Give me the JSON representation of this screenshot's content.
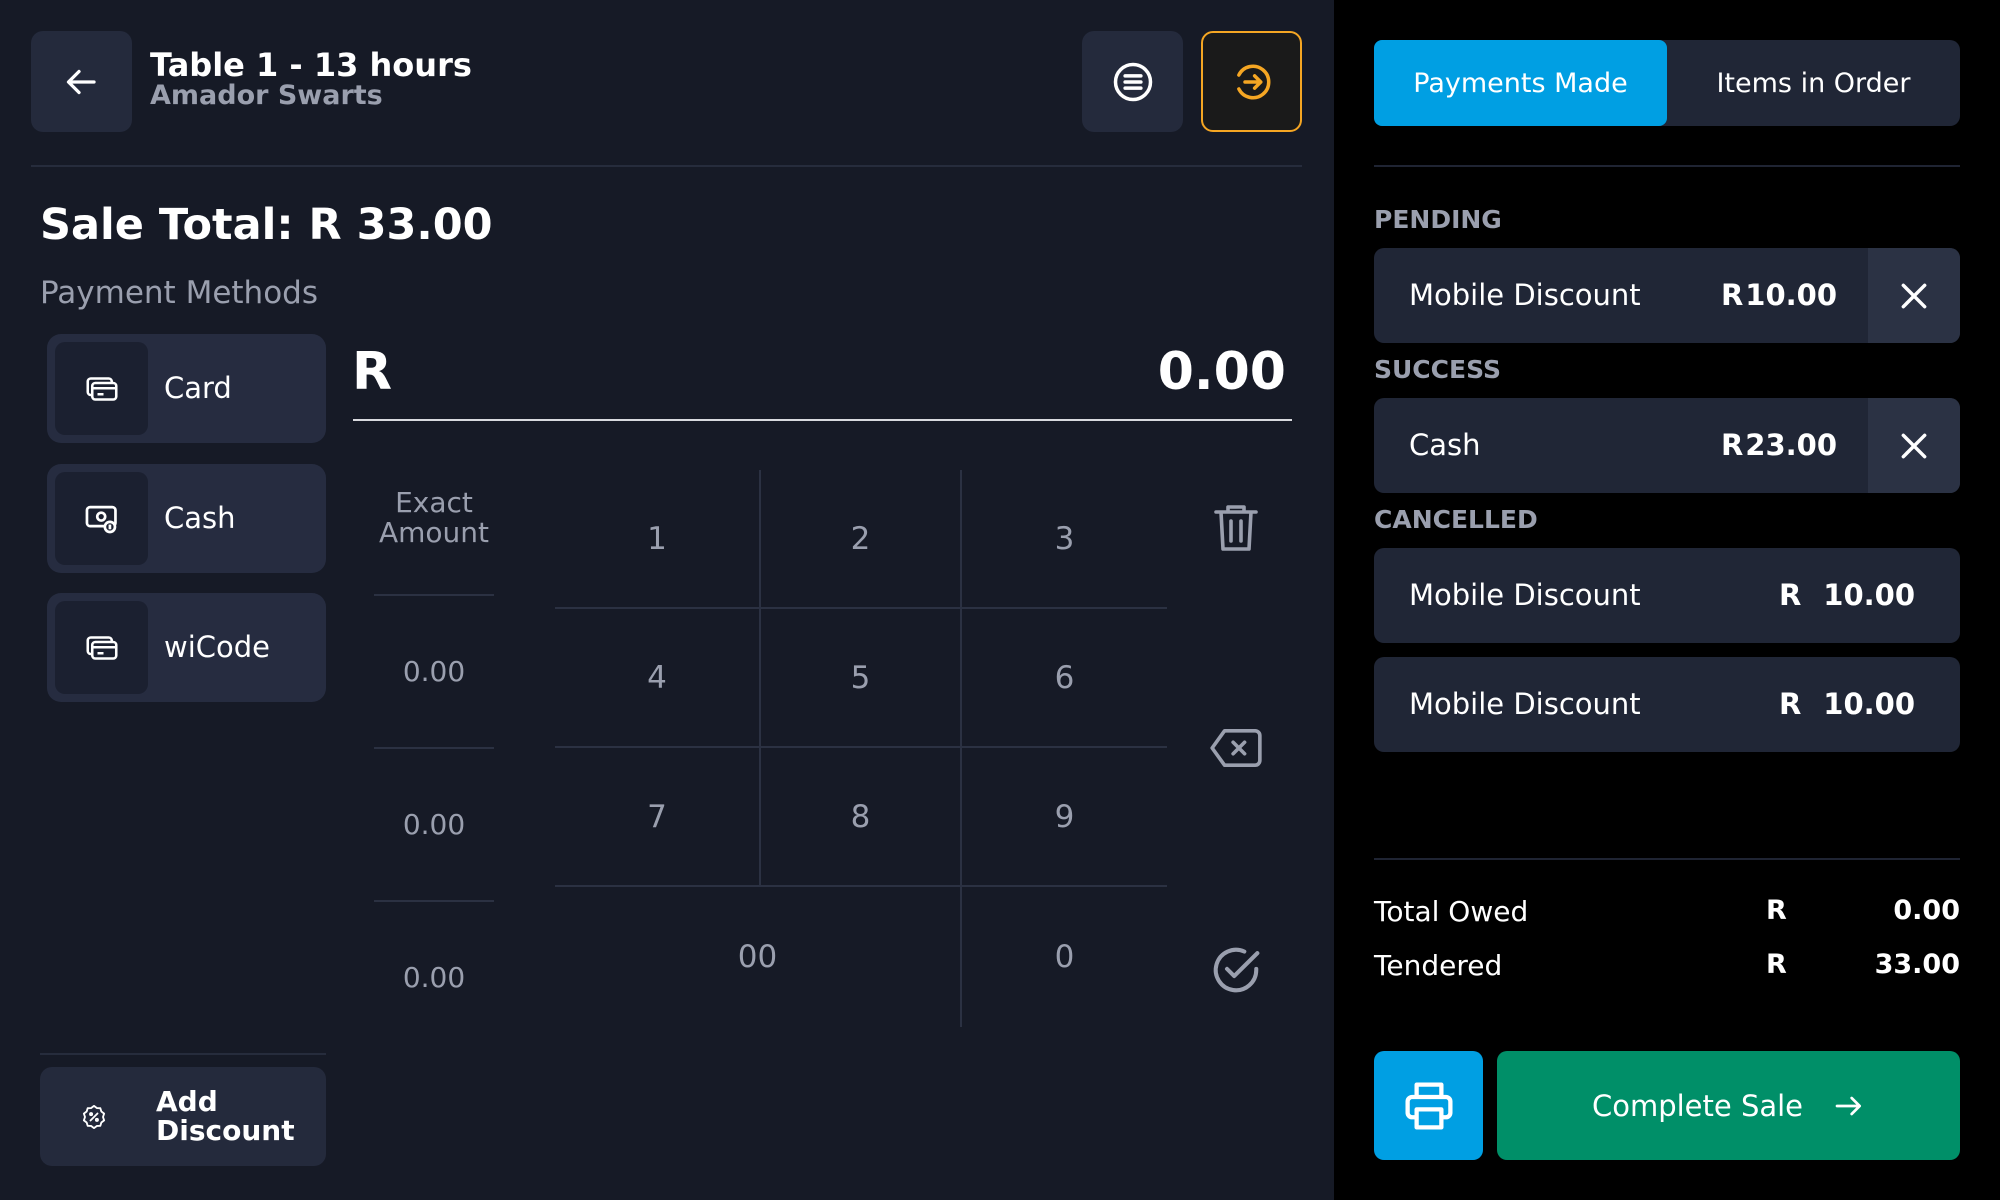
{
  "header": {
    "title": "Table 1 - 13 hours",
    "subtitle": "Amador Swarts"
  },
  "sale_total": "Sale Total: R 33.00",
  "payment_methods_title": "Payment Methods",
  "payment_methods": [
    {
      "label": "Card",
      "icon": "card-icon"
    },
    {
      "label": "Cash",
      "icon": "cash-icon"
    },
    {
      "label": "wiCode",
      "icon": "wicode-icon"
    }
  ],
  "add_discount_label": "Add Discount",
  "amount": {
    "currency": "R",
    "value": "0.00"
  },
  "quick_amounts": {
    "exact_label": "Exact Amount",
    "values": [
      "0.00",
      "0.00",
      "0.00"
    ]
  },
  "keypad": {
    "keys": [
      "1",
      "2",
      "3",
      "4",
      "5",
      "6",
      "7",
      "8",
      "9",
      "00",
      "0"
    ]
  },
  "tabs": [
    {
      "label": "Payments Made",
      "active": true
    },
    {
      "label": "Items in Order",
      "active": false
    }
  ],
  "sections": {
    "pending": {
      "label": "PENDING",
      "rows": [
        {
          "name": "Mobile Discount",
          "currency": "R",
          "amount": "10.00"
        }
      ]
    },
    "success": {
      "label": "SUCCESS",
      "rows": [
        {
          "name": "Cash",
          "currency": "R",
          "amount": "23.00"
        }
      ]
    },
    "cancelled": {
      "label": "CANCELLED",
      "rows": [
        {
          "name": "Mobile Discount",
          "currency": "R",
          "amount": "10.00"
        },
        {
          "name": "Mobile Discount",
          "currency": "R",
          "amount": "10.00"
        }
      ]
    }
  },
  "summary": {
    "total_owed": {
      "label": "Total Owed",
      "currency": "R",
      "value": "0.00"
    },
    "tendered": {
      "label": "Tendered",
      "currency": "R",
      "value": "33.00"
    }
  },
  "complete_sale_label": "Complete Sale",
  "colors": {
    "accent_blue": "#009fe3",
    "success_green": "#008f68",
    "exit_orange": "#f5a623",
    "panel_bg": "#161a26"
  }
}
